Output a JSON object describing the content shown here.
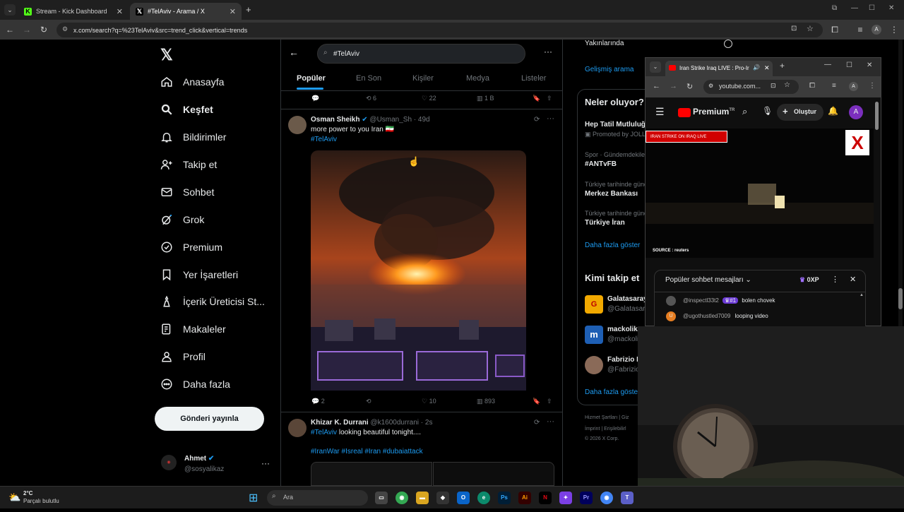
{
  "browser": {
    "tabs": [
      {
        "label": "Stream - Kick Dashboard"
      },
      {
        "label": "#TelAviv - Arama / X"
      }
    ],
    "url": "x.com/search?q=%23TelAviv&src=trend_click&vertical=trends",
    "profile_initial": "A"
  },
  "nav": {
    "items": [
      {
        "label": "Anasayfa",
        "icon": "home-icon"
      },
      {
        "label": "Keşfet",
        "icon": "search-icon"
      },
      {
        "label": "Bildirimler",
        "icon": "bell-icon"
      },
      {
        "label": "Takip et",
        "icon": "person-plus-icon"
      },
      {
        "label": "Sohbet",
        "icon": "mail-icon"
      },
      {
        "label": "Grok",
        "icon": "grok-icon"
      },
      {
        "label": "Premium",
        "icon": "premium-icon"
      },
      {
        "label": "Yer İşaretleri",
        "icon": "bookmark-icon"
      },
      {
        "label": "İçerik Üreticisi St...",
        "icon": "creator-icon"
      },
      {
        "label": "Makaleler",
        "icon": "article-icon"
      },
      {
        "label": "Profil",
        "icon": "profile-icon"
      },
      {
        "label": "Daha fazla",
        "icon": "more-icon"
      }
    ],
    "post_label": "Gönderi yayınla",
    "account": {
      "name": "Ahmet",
      "handle": "@sosyalikaz"
    }
  },
  "search": {
    "query": "#TelAviv",
    "tabs": [
      "Popüler",
      "En Son",
      "Kişiler",
      "Medya",
      "Listeler"
    ]
  },
  "prev_actions": {
    "retweets": "6",
    "likes": "22",
    "views": "1 B"
  },
  "tweet1": {
    "name": "Osman Sheikh",
    "handle": "@Usman_Sh",
    "time": "· 49d",
    "text": "more power to you Iran 🇮🇷",
    "hashtag": "#TelAviv",
    "replies": "2",
    "likes": "10",
    "views": "893"
  },
  "tweet2": {
    "name": "Khizar K. Durrani",
    "handle": "@k1600durrani",
    "time": "· 2s",
    "hashtag": "#TelAviv",
    "text": "looking beautiful tonight....",
    "tags": "#IranWar #Isreal #Iran #dubaiattack"
  },
  "right": {
    "nearby": "Yakınlarında",
    "advanced": "Gelişmiş arama",
    "trends_title": "Neler oluyor?",
    "trends": [
      {
        "meta": "",
        "name": "Hep Tatil Mutluluğ",
        "extra": "Promoted by JOLLY"
      },
      {
        "meta": "Spor · Gündemdekiler",
        "name": "#ANTvFB"
      },
      {
        "meta": "Türkiye tarihinde günd",
        "name": "Merkez Bankası"
      },
      {
        "meta": "Türkiye tarihinde günd",
        "name": "Türkiye İran"
      }
    ],
    "show_more": "Daha fazla göster",
    "follow_title": "Kimi takip et",
    "follow": [
      {
        "name": "Galatasaray",
        "handle": "@Galatasar"
      },
      {
        "name": "mackolik",
        "handle": "@mackoli"
      },
      {
        "name": "Fabrizio R",
        "handle": "@Fabrizio"
      }
    ],
    "show_more2": "Daha fazla göste",
    "footer1": "Hizmet Şartları  |  Giz",
    "footer2": "İmprint  |  Erişilebilirl",
    "footer3": "© 2026 X Corp."
  },
  "yt": {
    "tab": "Iran Strike Iraq LIVE : Pro-Ir",
    "url": "youtube.com...",
    "premium": "Premium",
    "premium_sup": "TR",
    "create": "Oluştur",
    "avatar": "A",
    "banner": "IRAN STRIKE ON IRAQ LIVE",
    "source": "SOURCE : reuters",
    "chat_title": "Popüler sohbet mesajları",
    "xp": "0XP",
    "messages": [
      {
        "user": "@inspectl33t2",
        "badge": "#1",
        "text": "bolen chovek"
      },
      {
        "user": "@ugothustled7009",
        "text": "looping video"
      }
    ]
  },
  "taskbar": {
    "temp": "2°C",
    "weather": "Parçalı bulutlu",
    "search": "Ara"
  }
}
